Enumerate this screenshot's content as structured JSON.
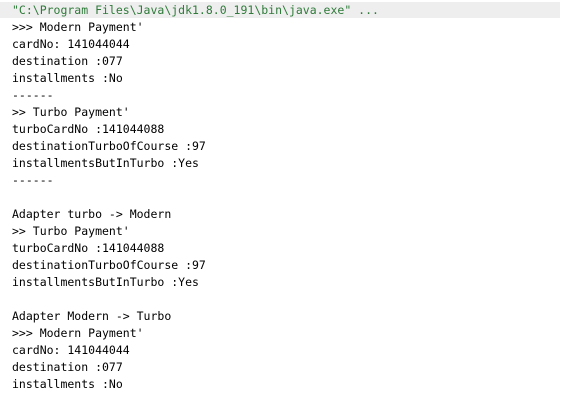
{
  "console": {
    "command": "\"C:\\Program Files\\Java\\jdk1.8.0_191\\bin\\java.exe\" ...",
    "output": [
      ">>> Modern Payment'",
      "cardNo: 141044044",
      "destination :077",
      "installments :No",
      "------",
      ">> Turbo Payment'",
      "turboCardNo :141044088",
      "destinationTurboOfCourse :97",
      "installmentsButInTurbo :Yes",
      "------",
      "",
      "Adapter turbo -> Modern",
      ">> Turbo Payment'",
      "turboCardNo :141044088",
      "destinationTurboOfCourse :97",
      "installmentsButInTurbo :Yes",
      "",
      "Adapter Modern -> Turbo",
      ">>> Modern Payment'",
      "cardNo: 141044044",
      "destination :077",
      "installments :No"
    ]
  },
  "colors": {
    "command_text": "#2f7a3a",
    "command_background": "#eeeeee",
    "output_text": "#000000",
    "background": "#ffffff"
  }
}
